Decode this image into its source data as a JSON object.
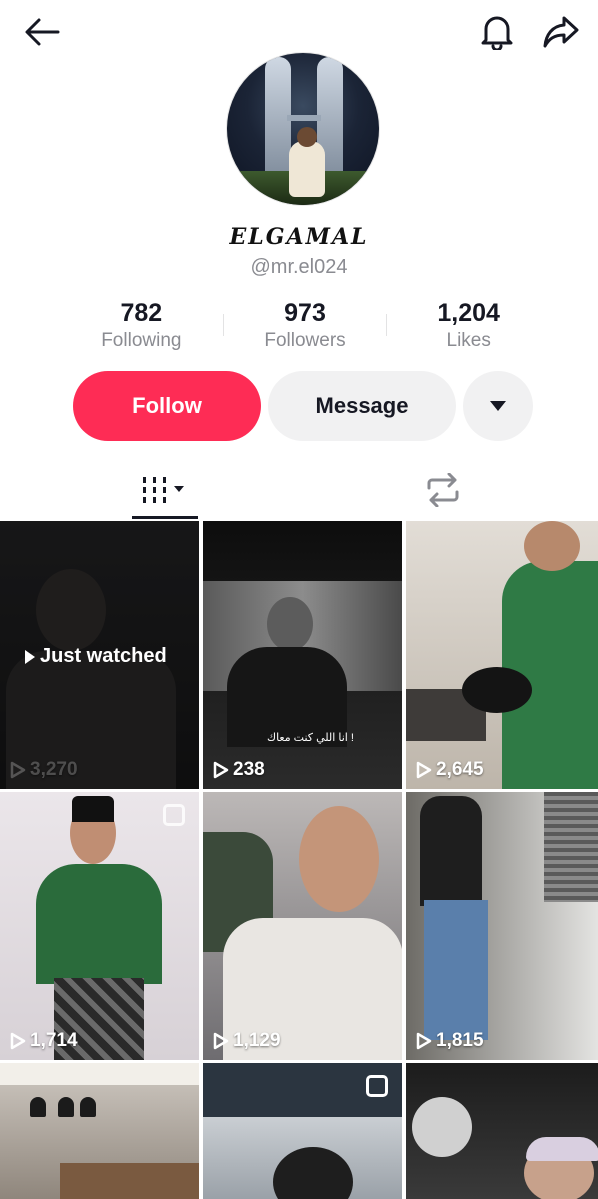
{
  "profile": {
    "display_name": "ELGAMAL",
    "handle": "@mr.el024"
  },
  "stats": {
    "following_count": "782",
    "following_label": "Following",
    "followers_count": "973",
    "followers_label": "Followers",
    "likes_count": "1,204",
    "likes_label": "Likes"
  },
  "actions": {
    "follow_label": "Follow",
    "message_label": "Message"
  },
  "colors": {
    "follow_accent": "#fe2c55",
    "secondary_button": "#f1f1f2",
    "muted_text": "#8a8b91"
  },
  "videos": [
    {
      "views": "3,270",
      "badge": "Just watched"
    },
    {
      "views": "238",
      "caption": "انا اللي كنت معاك !"
    },
    {
      "views": "2,645"
    },
    {
      "views": "1,714"
    },
    {
      "views": "1,129"
    },
    {
      "views": "1,815"
    },
    {
      "views": ""
    },
    {
      "views": ""
    },
    {
      "views": ""
    }
  ]
}
